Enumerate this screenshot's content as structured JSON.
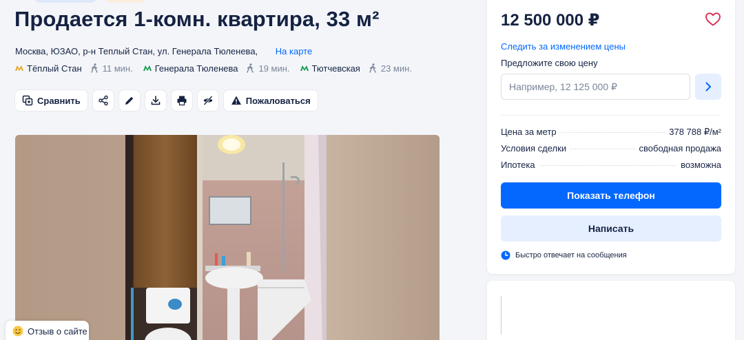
{
  "listing": {
    "title": "Продается 1-комн. квартира, 33 м²",
    "address": "Москва, ЮЗАО, р-н Теплый Стан, ул. Генерала Тюленева,",
    "map_link": "На карте",
    "metro": [
      {
        "name": "Тёплый Стан",
        "walk": "11 мин.",
        "color": "#e8a41b"
      },
      {
        "name": "Генерала Тюленева",
        "walk": "19 мин.",
        "color": "#0b9b47"
      },
      {
        "name": "Тютчевская",
        "walk": "23 мин.",
        "color": "#0b9b47"
      }
    ]
  },
  "actions": {
    "compare": "Сравнить",
    "complain": "Пожаловаться",
    "icons": [
      "compare-icon",
      "share-icon",
      "edit-icon",
      "download-icon",
      "print-icon",
      "hide-icon",
      "warning-icon"
    ]
  },
  "sidebar": {
    "price": "12 500 000 ₽",
    "follow_price": "Следить за изменением цены",
    "offer_label": "Предложите свою цену",
    "offer_placeholder": "Например, 12 125 000 ₽",
    "details": [
      {
        "key": "Цена за метр",
        "value": "378 788 ₽/м²"
      },
      {
        "key": "Условия сделки",
        "value": "свободная продажа"
      },
      {
        "key": "Ипотека",
        "value": "возможна"
      }
    ],
    "show_phone": "Показать телефон",
    "write": "Написать",
    "fast_reply": "Быстро отвечает на сообщения"
  },
  "feedback": {
    "label": "Отзыв о сайте"
  },
  "colors": {
    "accent": "#0468ff",
    "accent_light": "#e6efff",
    "text": "#152242",
    "muted": "#7a8599",
    "heart": "#d8264d"
  }
}
